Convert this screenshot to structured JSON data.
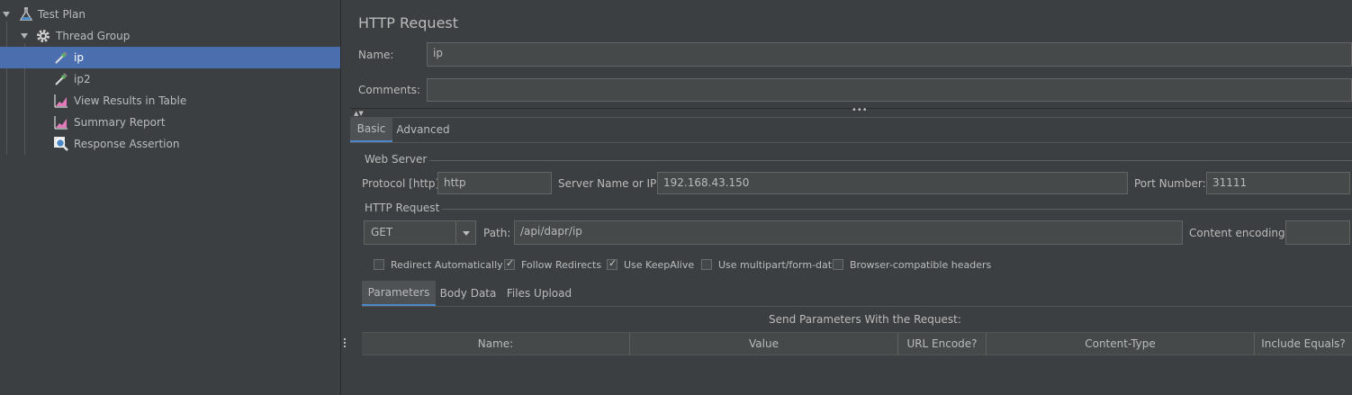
{
  "tree": {
    "items": [
      {
        "label": "Test Plan",
        "icon": "flask-icon"
      },
      {
        "label": "Thread Group",
        "icon": "gear-icon"
      },
      {
        "label": "ip",
        "icon": "pipette-icon"
      },
      {
        "label": "ip2",
        "icon": "pipette-icon"
      },
      {
        "label": "View Results in Table",
        "icon": "chart-icon"
      },
      {
        "label": "Summary Report",
        "icon": "chart-icon"
      },
      {
        "label": "Response Assertion",
        "icon": "magnifier-icon"
      }
    ]
  },
  "panel": {
    "title": "HTTP Request",
    "name_label": "Name:",
    "name_value": "ip",
    "comments_label": "Comments:",
    "comments_value": "",
    "tabs": [
      "Basic",
      "Advanced"
    ],
    "web_server": {
      "group_title": "Web Server",
      "protocol_label": "Protocol [http]:",
      "protocol_value": "http",
      "server_label": "Server Name or IP:",
      "server_value": "192.168.43.150",
      "port_label": "Port Number:",
      "port_value": "31111"
    },
    "http_request": {
      "group_title": "HTTP Request",
      "method": "GET",
      "path_label": "Path:",
      "path_value": "/api/dapr/ip",
      "encoding_label": "Content encoding:",
      "encoding_value": ""
    },
    "checkboxes": [
      {
        "label": "Redirect Automatically",
        "checked": false
      },
      {
        "label": "Follow Redirects",
        "checked": true
      },
      {
        "label": "Use KeepAlive",
        "checked": true
      },
      {
        "label": "Use multipart/form-data",
        "checked": false
      },
      {
        "label": "Browser-compatible headers",
        "checked": false
      }
    ],
    "sub_tabs": [
      "Parameters",
      "Body Data",
      "Files Upload"
    ],
    "params_caption": "Send Parameters With the Request:",
    "columns": [
      "Name:",
      "Value",
      "URL Encode?",
      "Content-Type",
      "Include Equals?"
    ]
  },
  "colors": {
    "selection": "#4b6eaf",
    "background": "#3c3f41",
    "accent": "#4a88c7"
  }
}
